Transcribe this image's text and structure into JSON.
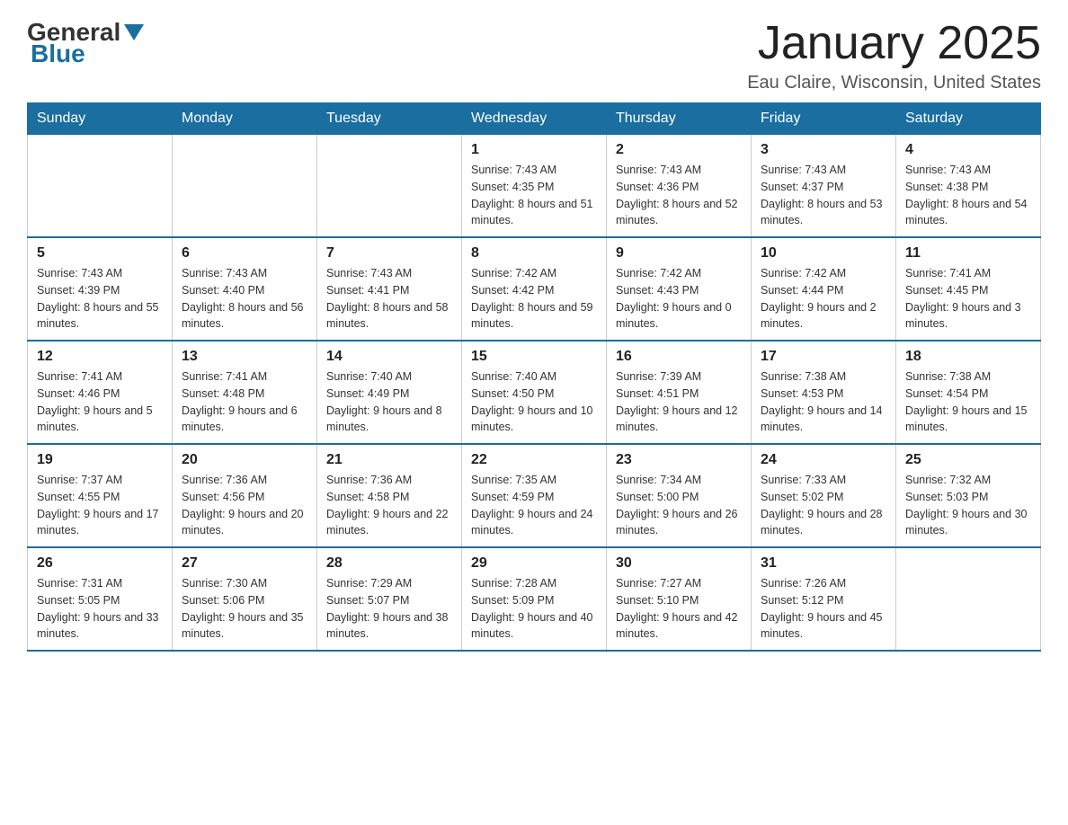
{
  "header": {
    "logo": {
      "general": "General",
      "blue": "Blue"
    },
    "title": "January 2025",
    "location": "Eau Claire, Wisconsin, United States"
  },
  "calendar": {
    "days_of_week": [
      "Sunday",
      "Monday",
      "Tuesday",
      "Wednesday",
      "Thursday",
      "Friday",
      "Saturday"
    ],
    "weeks": [
      [
        {
          "day": "",
          "info": ""
        },
        {
          "day": "",
          "info": ""
        },
        {
          "day": "",
          "info": ""
        },
        {
          "day": "1",
          "info": "Sunrise: 7:43 AM\nSunset: 4:35 PM\nDaylight: 8 hours\nand 51 minutes."
        },
        {
          "day": "2",
          "info": "Sunrise: 7:43 AM\nSunset: 4:36 PM\nDaylight: 8 hours\nand 52 minutes."
        },
        {
          "day": "3",
          "info": "Sunrise: 7:43 AM\nSunset: 4:37 PM\nDaylight: 8 hours\nand 53 minutes."
        },
        {
          "day": "4",
          "info": "Sunrise: 7:43 AM\nSunset: 4:38 PM\nDaylight: 8 hours\nand 54 minutes."
        }
      ],
      [
        {
          "day": "5",
          "info": "Sunrise: 7:43 AM\nSunset: 4:39 PM\nDaylight: 8 hours\nand 55 minutes."
        },
        {
          "day": "6",
          "info": "Sunrise: 7:43 AM\nSunset: 4:40 PM\nDaylight: 8 hours\nand 56 minutes."
        },
        {
          "day": "7",
          "info": "Sunrise: 7:43 AM\nSunset: 4:41 PM\nDaylight: 8 hours\nand 58 minutes."
        },
        {
          "day": "8",
          "info": "Sunrise: 7:42 AM\nSunset: 4:42 PM\nDaylight: 8 hours\nand 59 minutes."
        },
        {
          "day": "9",
          "info": "Sunrise: 7:42 AM\nSunset: 4:43 PM\nDaylight: 9 hours\nand 0 minutes."
        },
        {
          "day": "10",
          "info": "Sunrise: 7:42 AM\nSunset: 4:44 PM\nDaylight: 9 hours\nand 2 minutes."
        },
        {
          "day": "11",
          "info": "Sunrise: 7:41 AM\nSunset: 4:45 PM\nDaylight: 9 hours\nand 3 minutes."
        }
      ],
      [
        {
          "day": "12",
          "info": "Sunrise: 7:41 AM\nSunset: 4:46 PM\nDaylight: 9 hours\nand 5 minutes."
        },
        {
          "day": "13",
          "info": "Sunrise: 7:41 AM\nSunset: 4:48 PM\nDaylight: 9 hours\nand 6 minutes."
        },
        {
          "day": "14",
          "info": "Sunrise: 7:40 AM\nSunset: 4:49 PM\nDaylight: 9 hours\nand 8 minutes."
        },
        {
          "day": "15",
          "info": "Sunrise: 7:40 AM\nSunset: 4:50 PM\nDaylight: 9 hours\nand 10 minutes."
        },
        {
          "day": "16",
          "info": "Sunrise: 7:39 AM\nSunset: 4:51 PM\nDaylight: 9 hours\nand 12 minutes."
        },
        {
          "day": "17",
          "info": "Sunrise: 7:38 AM\nSunset: 4:53 PM\nDaylight: 9 hours\nand 14 minutes."
        },
        {
          "day": "18",
          "info": "Sunrise: 7:38 AM\nSunset: 4:54 PM\nDaylight: 9 hours\nand 15 minutes."
        }
      ],
      [
        {
          "day": "19",
          "info": "Sunrise: 7:37 AM\nSunset: 4:55 PM\nDaylight: 9 hours\nand 17 minutes."
        },
        {
          "day": "20",
          "info": "Sunrise: 7:36 AM\nSunset: 4:56 PM\nDaylight: 9 hours\nand 20 minutes."
        },
        {
          "day": "21",
          "info": "Sunrise: 7:36 AM\nSunset: 4:58 PM\nDaylight: 9 hours\nand 22 minutes."
        },
        {
          "day": "22",
          "info": "Sunrise: 7:35 AM\nSunset: 4:59 PM\nDaylight: 9 hours\nand 24 minutes."
        },
        {
          "day": "23",
          "info": "Sunrise: 7:34 AM\nSunset: 5:00 PM\nDaylight: 9 hours\nand 26 minutes."
        },
        {
          "day": "24",
          "info": "Sunrise: 7:33 AM\nSunset: 5:02 PM\nDaylight: 9 hours\nand 28 minutes."
        },
        {
          "day": "25",
          "info": "Sunrise: 7:32 AM\nSunset: 5:03 PM\nDaylight: 9 hours\nand 30 minutes."
        }
      ],
      [
        {
          "day": "26",
          "info": "Sunrise: 7:31 AM\nSunset: 5:05 PM\nDaylight: 9 hours\nand 33 minutes."
        },
        {
          "day": "27",
          "info": "Sunrise: 7:30 AM\nSunset: 5:06 PM\nDaylight: 9 hours\nand 35 minutes."
        },
        {
          "day": "28",
          "info": "Sunrise: 7:29 AM\nSunset: 5:07 PM\nDaylight: 9 hours\nand 38 minutes."
        },
        {
          "day": "29",
          "info": "Sunrise: 7:28 AM\nSunset: 5:09 PM\nDaylight: 9 hours\nand 40 minutes."
        },
        {
          "day": "30",
          "info": "Sunrise: 7:27 AM\nSunset: 5:10 PM\nDaylight: 9 hours\nand 42 minutes."
        },
        {
          "day": "31",
          "info": "Sunrise: 7:26 AM\nSunset: 5:12 PM\nDaylight: 9 hours\nand 45 minutes."
        },
        {
          "day": "",
          "info": ""
        }
      ]
    ]
  }
}
